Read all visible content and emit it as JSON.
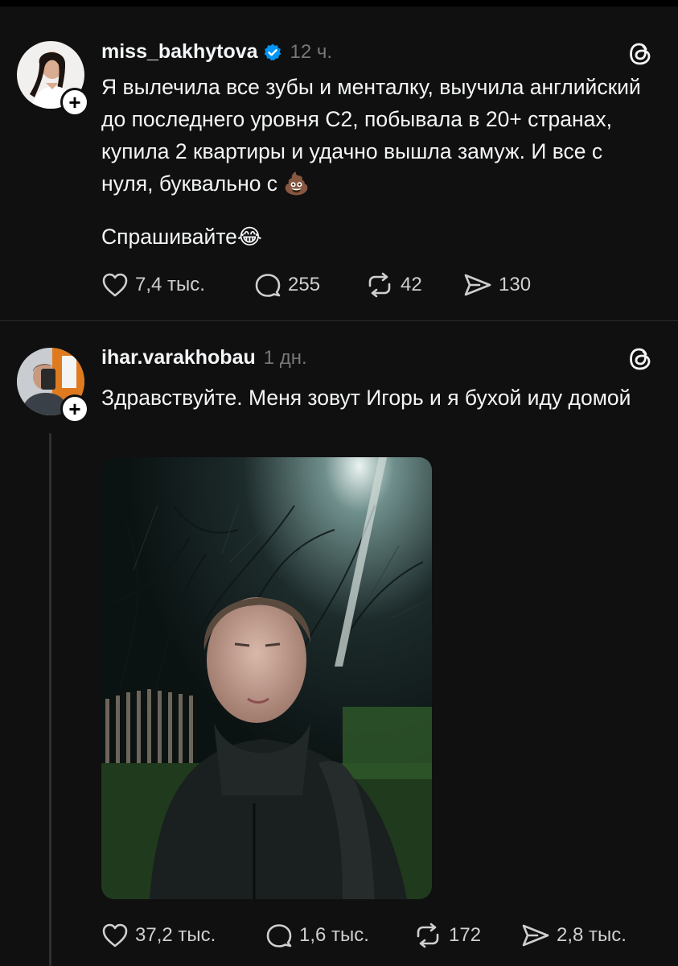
{
  "posts": [
    {
      "username": "miss_bakhytova",
      "verified": true,
      "time": "12 ч.",
      "text": "Я вылечила все зубы и менталку, выучила английский до последнего уровня С2, побывала в 20+ странах, купила 2 квартиры и удачно вышла замуж. И все с нуля, буквально с 💩",
      "text2": "Спрашивайте😂",
      "likes": "7,4 тыс.",
      "comments": "255",
      "reposts": "42",
      "shares": "130"
    },
    {
      "username": "ihar.varakhobau",
      "verified": false,
      "time": "1 дн.",
      "text": "Здравствуйте. Меня зовут Игорь и я бухой иду домой",
      "likes": "37,2 тыс.",
      "comments": "1,6 тыс.",
      "reposts": "172",
      "shares": "2,8 тыс."
    }
  ],
  "icons": {
    "follow": "+",
    "verified_color": "#0095f6",
    "app": "threads-logo-icon"
  }
}
